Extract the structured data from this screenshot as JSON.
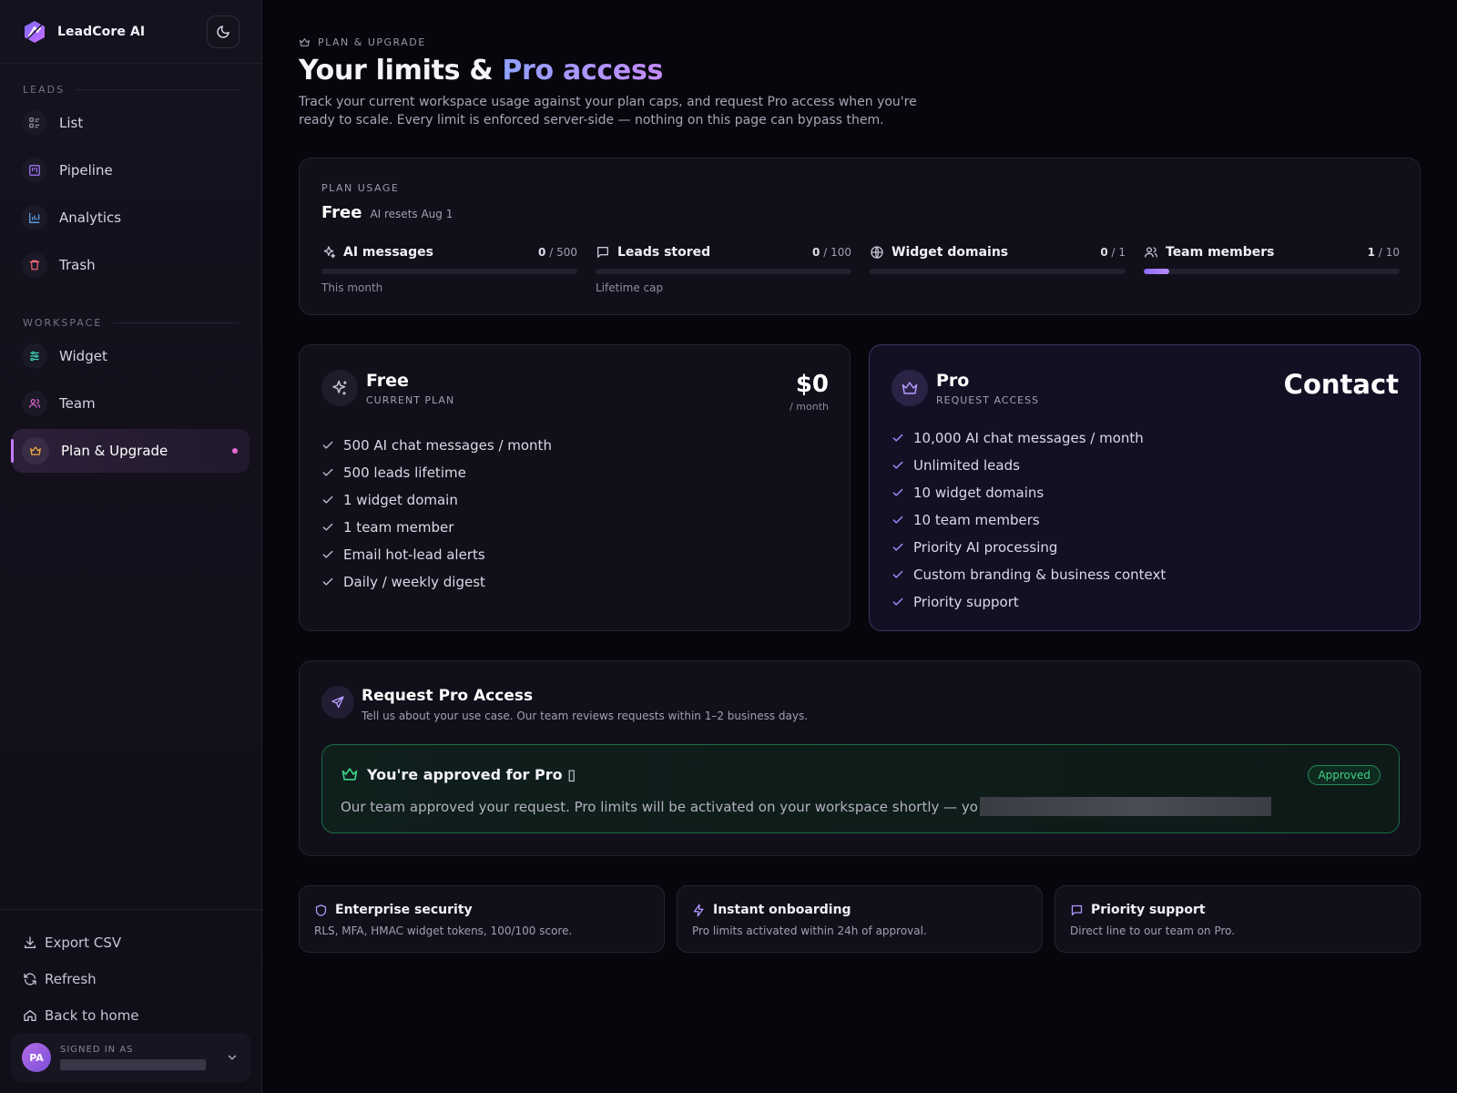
{
  "brand": {
    "name": "LeadCore AI",
    "accent": "#c779ff"
  },
  "sidebar": {
    "sections": [
      {
        "label": "LEADS",
        "items": [
          {
            "label": "List",
            "icon": "list-icon"
          },
          {
            "label": "Pipeline",
            "icon": "kanban-icon"
          },
          {
            "label": "Analytics",
            "icon": "bar-chart-icon"
          },
          {
            "label": "Trash",
            "icon": "trash-icon"
          }
        ]
      },
      {
        "label": "WORKSPACE",
        "items": [
          {
            "label": "Widget",
            "icon": "sliders-icon"
          },
          {
            "label": "Team",
            "icon": "users-icon"
          },
          {
            "label": "Plan & Upgrade",
            "icon": "crown-icon",
            "active": true
          }
        ]
      }
    ],
    "footer": [
      {
        "label": "Export CSV",
        "icon": "download-icon"
      },
      {
        "label": "Refresh",
        "icon": "refresh-icon"
      },
      {
        "label": "Back to home",
        "icon": "home-icon"
      }
    ],
    "user": {
      "initials": "PA",
      "signed_label": "SIGNED IN AS"
    }
  },
  "header": {
    "eyebrow": "PLAN & UPGRADE",
    "title_prefix": "Your limits &",
    "title_accent": "Pro access",
    "subtitle": "Track your current workspace usage against your plan caps, and request Pro access when you're ready to scale. Every limit is enforced server-side — nothing on this page can bypass them."
  },
  "usage": {
    "label": "PLAN USAGE",
    "plan": "Free",
    "reset": "AI resets Aug 1",
    "meters": [
      {
        "name": "AI messages",
        "used": "0",
        "cap": "/ 500",
        "fraction": 0,
        "note": "This month",
        "icon": "sparkles-icon"
      },
      {
        "name": "Leads stored",
        "used": "0",
        "cap": "/ 100",
        "fraction": 0,
        "note": "Lifetime cap",
        "icon": "message-icon"
      },
      {
        "name": "Widget domains",
        "used": "0",
        "cap": "/ 1",
        "fraction": 0,
        "note": "",
        "icon": "globe-icon"
      },
      {
        "name": "Team members",
        "used": "1",
        "cap": "/ 10",
        "fraction": 0.1,
        "note": "",
        "icon": "users-icon"
      }
    ]
  },
  "plans": {
    "free": {
      "name": "Free",
      "tag": "CURRENT PLAN",
      "price": "$0",
      "period": "/ month",
      "features": [
        "500 AI chat messages / month",
        "500 leads lifetime",
        "1 widget domain",
        "1 team member",
        "Email hot-lead alerts",
        "Daily / weekly digest"
      ]
    },
    "pro": {
      "name": "Pro",
      "tag": "REQUEST ACCESS",
      "price": "Contact",
      "features": [
        "10,000 AI chat messages / month",
        "Unlimited leads",
        "10 widget domains",
        "10 team members",
        "Priority AI processing",
        "Custom branding & business context",
        "Priority support"
      ]
    }
  },
  "request": {
    "title": "Request Pro Access",
    "subtitle": "Tell us about your use case. Our team reviews requests within 1–2 business days.",
    "approved_title": "You're approved for Pro ▯",
    "approved_badge": "Approved",
    "approved_msg": "Our team approved your request. Pro limits will be activated on your workspace shortly — yo"
  },
  "features": [
    {
      "title": "Enterprise security",
      "desc": "RLS, MFA, HMAC widget tokens, 100/100 score.",
      "icon": "shield-icon"
    },
    {
      "title": "Instant onboarding",
      "desc": "Pro limits activated within 24h of approval.",
      "icon": "bolt-icon"
    },
    {
      "title": "Priority support",
      "desc": "Direct line to our team on Pro.",
      "icon": "message-icon"
    }
  ],
  "colors": {
    "success": "#3ed387",
    "accent_gradient_start": "#8fa2ff",
    "accent_gradient_end": "#c58bff"
  }
}
